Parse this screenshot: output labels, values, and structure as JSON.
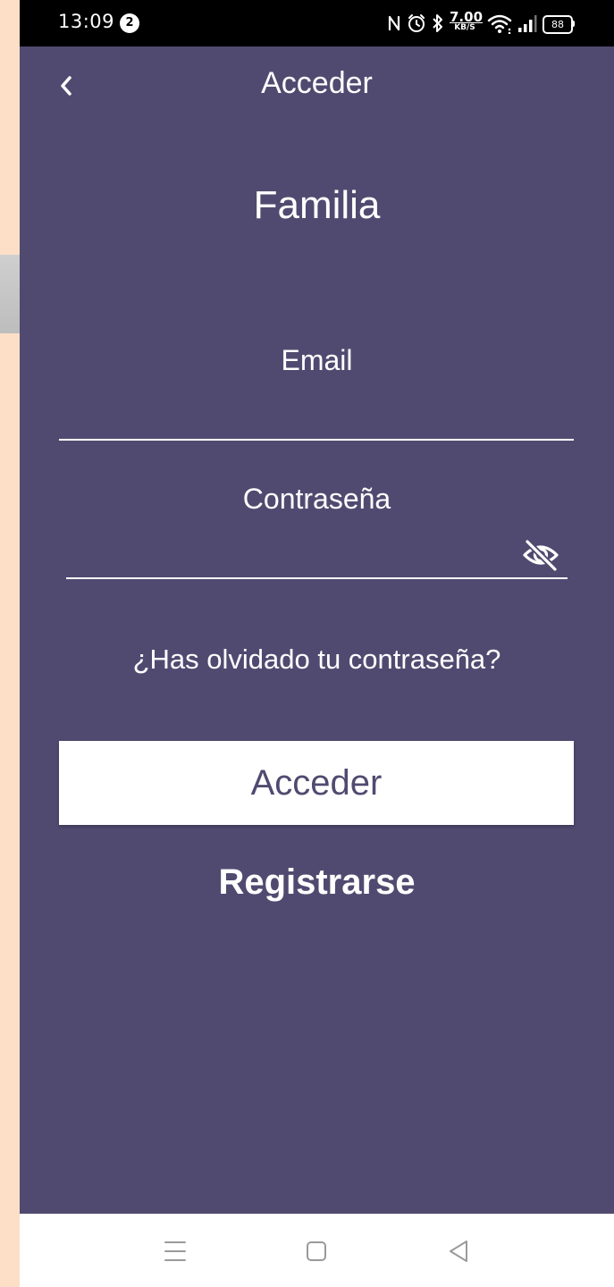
{
  "status_bar": {
    "time": "13:09",
    "notification_count": "2",
    "network_speed_value": "7.00",
    "network_speed_unit": "KB/S",
    "battery": "88"
  },
  "header": {
    "title": "Acceder",
    "back_icon": "chevron-left-icon"
  },
  "main": {
    "section_title": "Familia",
    "email": {
      "label": "Email",
      "value": ""
    },
    "password": {
      "label": "Contraseña",
      "value": "",
      "toggle_icon": "eye-off-icon"
    },
    "forgot_password": "¿Has olvidado tu contraseña?",
    "login_button": "Acceder",
    "register_link": "Registrarse"
  },
  "nav_bar": {
    "items": [
      "menu-icon",
      "home-icon",
      "back-icon"
    ]
  },
  "colors": {
    "background": "#514a70",
    "button_bg": "#ffffff",
    "button_text": "#514a70",
    "status_bar": "#000000"
  }
}
